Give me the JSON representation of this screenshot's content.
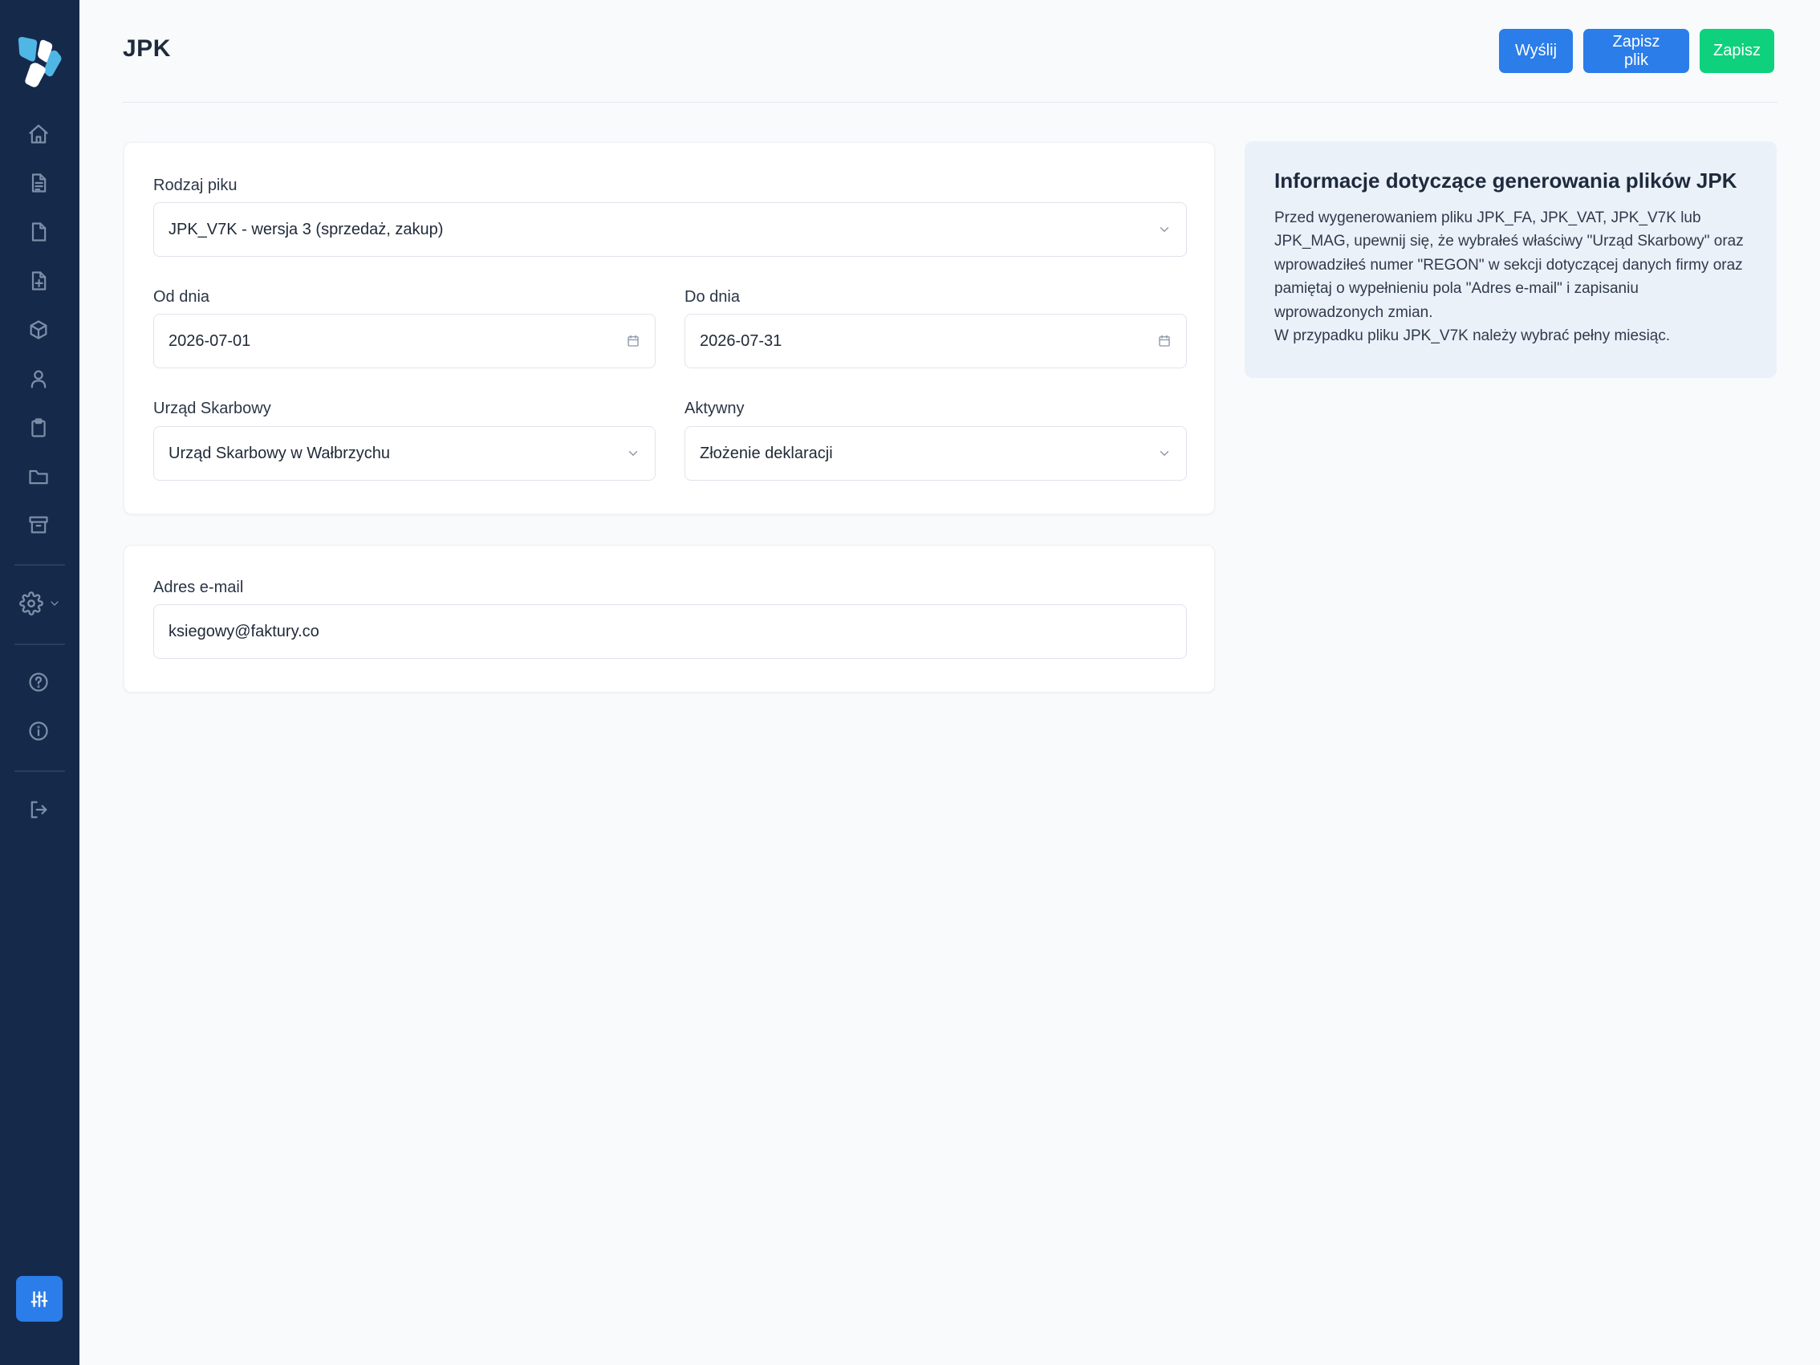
{
  "sidebar": {
    "nav_icons": [
      "home-icon",
      "document-icon",
      "file-icon",
      "file-plus-icon",
      "package-icon",
      "user-icon",
      "clipboard-icon",
      "folder-icon",
      "archive-icon"
    ],
    "settings_icon": "gear-icon",
    "help_icons": [
      "help-circle-icon",
      "info-circle-icon"
    ],
    "logout_icon": "logout-icon",
    "bottom_button_icon": "sliders-icon",
    "colors": {
      "background": "#15294a",
      "icon": "#7d8ea8",
      "accent": "#2b7de9"
    }
  },
  "header": {
    "title": "JPK",
    "actions": {
      "send": "Wyślij",
      "save_file": "Zapisz plik",
      "save": "Zapisz"
    },
    "colors": {
      "blue": "#2b7de9",
      "green": "#0fd17d"
    }
  },
  "form": {
    "file_type": {
      "label": "Rodzaj piku",
      "value": "JPK_V7K - wersja 3 (sprzedaż, zakup)"
    },
    "date_from": {
      "label": "Od dnia",
      "value": "2026-07-01"
    },
    "date_to": {
      "label": "Do dnia",
      "value": "2026-07-31"
    },
    "tax_office": {
      "label": "Urząd Skarbowy",
      "value": "Urząd Skarbowy w Wałbrzychu"
    },
    "active": {
      "label": "Aktywny",
      "value": "Złożenie deklaracji"
    },
    "email": {
      "label": "Adres e-mail",
      "value": "ksiegowy@faktury.co"
    }
  },
  "info": {
    "title": "Informacje dotyczące generowania plików JPK",
    "paragraph_1": "Przed wygenerowaniem pliku JPK_FA, JPK_VAT, JPK_V7K lub JPK_MAG, upewnij się, że wybrałeś właściwy \"Urząd Skarbowy\" oraz wprowadziłeś numer \"REGON\" w sekcji dotyczącej danych firmy oraz pamiętaj o wypełnieniu pola \"Adres e-mail\" i zapisaniu wprowadzonych zmian.",
    "paragraph_2": "W przypadku pliku JPK_V7K należy wybrać pełny miesiąc."
  }
}
